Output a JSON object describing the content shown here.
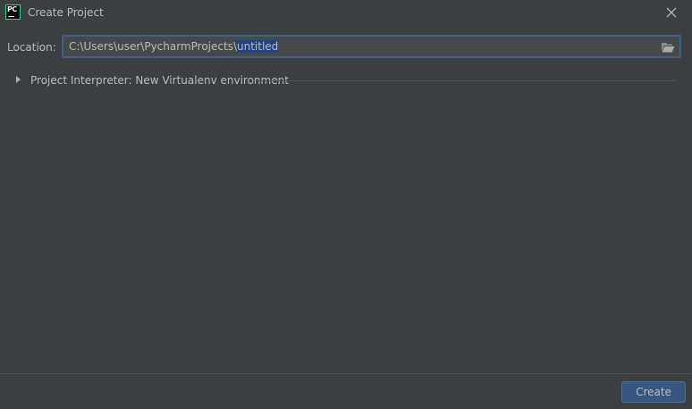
{
  "window": {
    "title": "Create Project",
    "app_icon_text": "PC"
  },
  "location": {
    "label": "Location:",
    "path_prefix": "C:\\Users\\user\\PycharmProjects\\",
    "path_selected": "untitled"
  },
  "interpreter": {
    "label": "Project Interpreter: New Virtualenv environment",
    "expanded": false
  },
  "footer": {
    "create_label": "Create"
  },
  "icons": {
    "app": "pycharm-logo-icon",
    "close": "close-icon",
    "folder": "folder-open-icon",
    "expand": "triangle-right-icon"
  },
  "colors": {
    "background": "#3c3f41",
    "field_background": "#45494a",
    "focus_border": "#3d6185",
    "selection": "#214283",
    "primary_button": "#365880",
    "text": "#bbbbbb"
  }
}
